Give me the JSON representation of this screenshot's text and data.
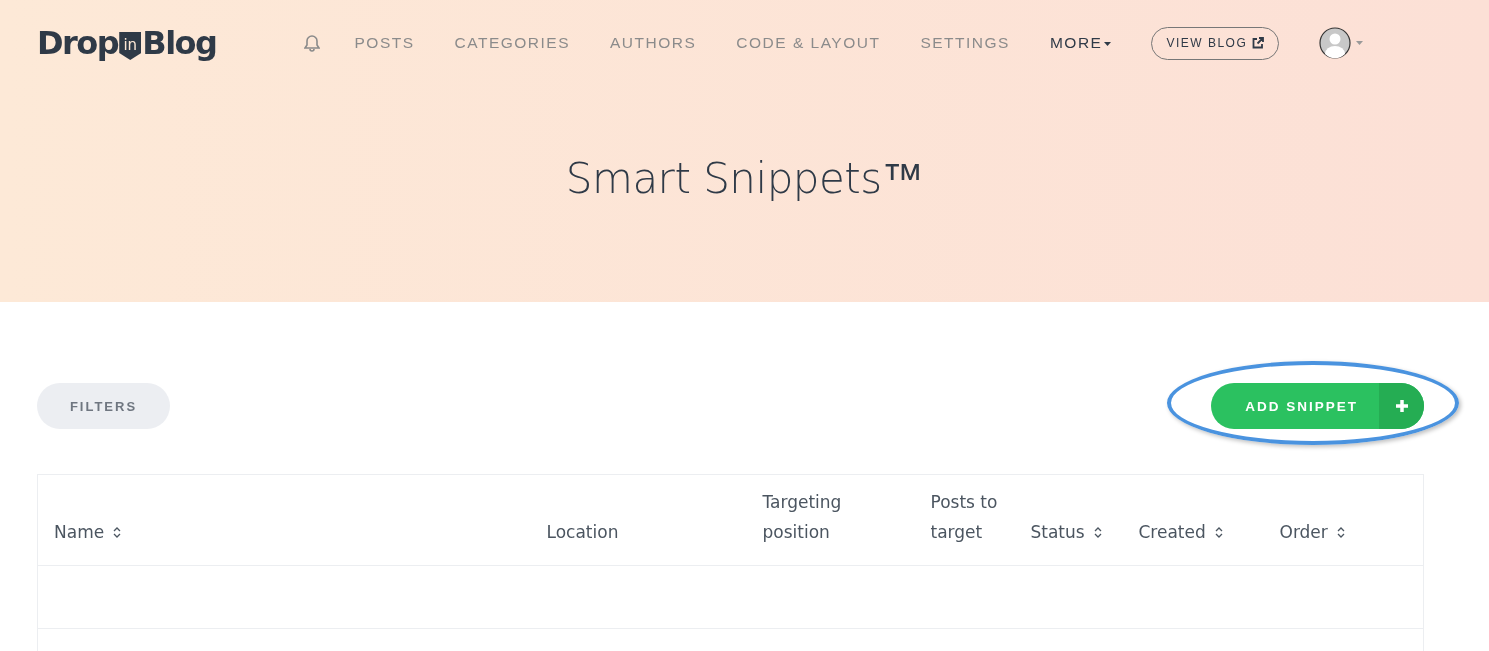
{
  "logo": {
    "before": "Drop",
    "badge": "in",
    "after": "Blog"
  },
  "nav": [
    {
      "label": "POSTS",
      "selected": false,
      "dropdown": false
    },
    {
      "label": "CATEGORIES",
      "selected": false,
      "dropdown": false
    },
    {
      "label": "AUTHORS",
      "selected": false,
      "dropdown": false
    },
    {
      "label": "CODE & LAYOUT",
      "selected": false,
      "dropdown": false
    },
    {
      "label": "SETTINGS",
      "selected": false,
      "dropdown": false
    },
    {
      "label": "MORE",
      "selected": true,
      "dropdown": true
    }
  ],
  "view_blog": {
    "label": "VIEW BLOG"
  },
  "page_title": "Smart Snippets™",
  "filters_button": {
    "label": "FILTERS"
  },
  "add_button": {
    "label": "ADD SNIPPET",
    "highlighted": true
  },
  "table": {
    "columns": [
      {
        "label": "Name",
        "sortable": true
      },
      {
        "label": "Location",
        "sortable": false
      },
      {
        "label": "Targeting position",
        "sortable": false
      },
      {
        "label": "Posts to target",
        "sortable": false
      },
      {
        "label": "Status",
        "sortable": true
      },
      {
        "label": "Created",
        "sortable": true
      },
      {
        "label": "Order",
        "sortable": true
      }
    ]
  }
}
